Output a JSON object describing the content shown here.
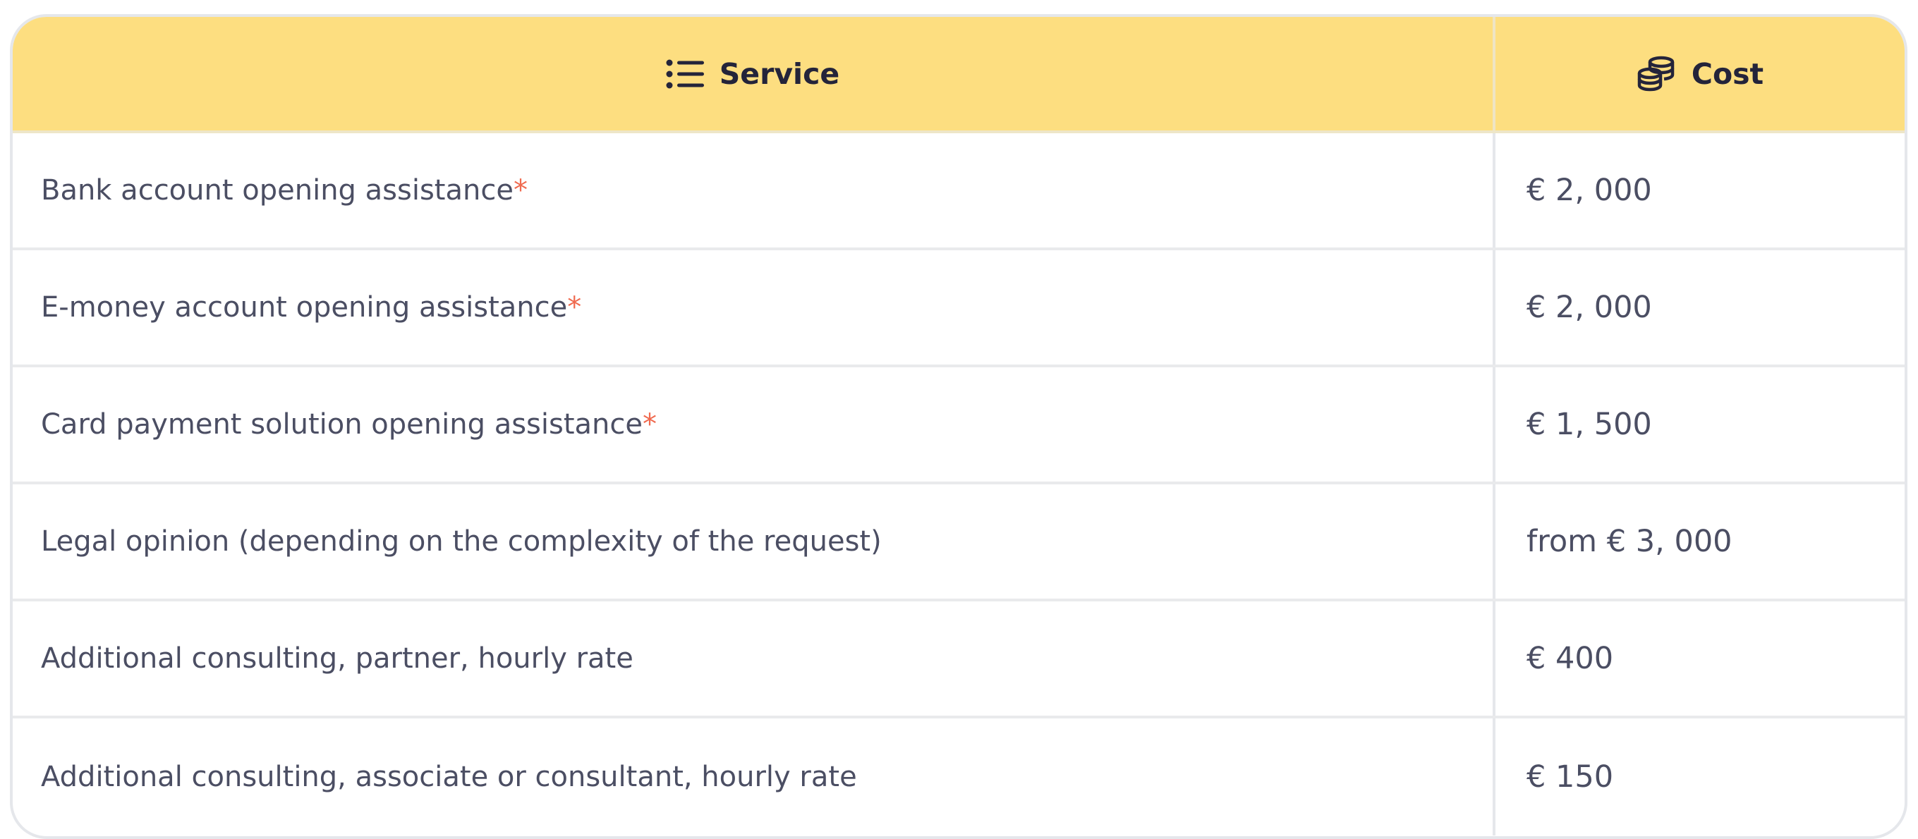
{
  "table": {
    "header": {
      "service_label": "Service",
      "service_icon": "list-icon",
      "cost_label": "Cost",
      "cost_icon": "coins-icon"
    },
    "rows": [
      {
        "service": "Bank account opening assistance",
        "asterisk": "*",
        "cost": "€ 2, 000"
      },
      {
        "service": "E-money account opening assistance",
        "asterisk": "*",
        "cost": "€ 2, 000"
      },
      {
        "service": "Card payment solution opening assistance",
        "asterisk": "*",
        "cost": "€ 1, 500"
      },
      {
        "service": "Legal opinion (depending on the complexity of the request)",
        "asterisk": "",
        "cost": "from € 3, 000"
      },
      {
        "service": "Additional consulting, partner, hourly rate",
        "asterisk": "",
        "cost": "€ 400"
      },
      {
        "service": "Additional consulting, associate or consultant, hourly rate",
        "asterisk": "",
        "cost": "€ 150"
      }
    ]
  },
  "colors": {
    "header_bg": "#fdde80",
    "text": "#4b4e63",
    "header_text": "#24243a",
    "asterisk": "#f06a4f",
    "border": "#e5e7eb"
  }
}
